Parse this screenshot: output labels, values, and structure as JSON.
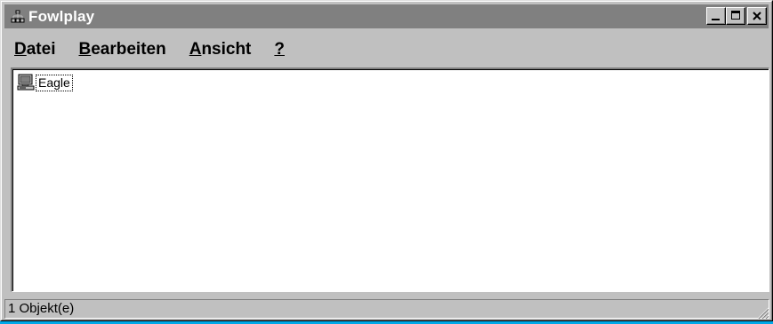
{
  "window": {
    "title": "Fowlplay",
    "app_icon": "network-tree-icon",
    "buttons": {
      "minimize": "minimize-icon",
      "maximize": "maximize-icon",
      "close": "close-icon"
    }
  },
  "menubar": {
    "items": [
      {
        "accel": "D",
        "rest": "atei"
      },
      {
        "accel": "B",
        "rest": "earbeiten"
      },
      {
        "accel": "A",
        "rest": "nsicht"
      },
      {
        "accel": "?",
        "rest": ""
      }
    ]
  },
  "content": {
    "items": [
      {
        "label": "Eagle",
        "icon": "computer-icon"
      }
    ]
  },
  "statusbar": {
    "text": "1 Objekt(e)"
  },
  "colors": {
    "desktop": "#00a8e8",
    "titlebar_inactive": "#808080",
    "face": "#c0c0c0"
  }
}
